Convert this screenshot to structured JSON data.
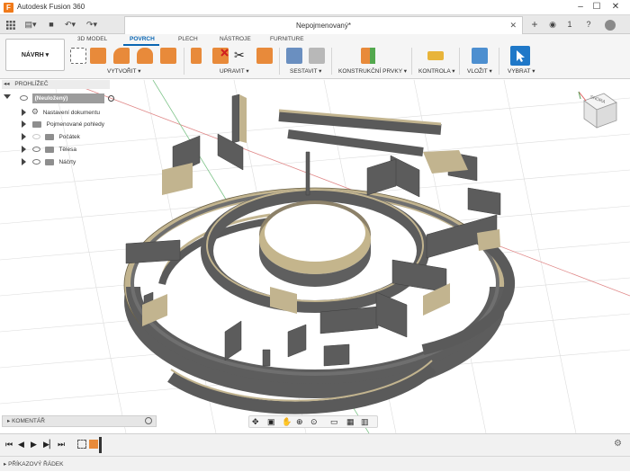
{
  "window": {
    "title": "Autodesk Fusion 360",
    "app_icon_letter": "F"
  },
  "document_tab": {
    "title": "Nepojmenovaný*"
  },
  "quick_access": {
    "data_panel_badge": "1"
  },
  "ribbon": {
    "workspace_label": "NÁVRH",
    "tabs": [
      "3D MODEL",
      "POVRCH",
      "PLECH",
      "NÁSTROJE",
      "FURNITURE"
    ],
    "active_tab": "POVRCH",
    "groups": [
      "VYTVOŘIT",
      "UPRAVIT",
      "SESTAVIT",
      "KONSTRUKČNÍ PRVKY",
      "KONTROLA",
      "VLOŽIT",
      "VYBRAT"
    ]
  },
  "browser": {
    "header": "PROHLÍŽEČ",
    "root_label": "(Neuložený)",
    "items": [
      "Nastavení dokumentu",
      "Pojmenované pohledy",
      "Počátek",
      "Tělesa",
      "Náčrty"
    ]
  },
  "viewcube": {
    "face_label": "SHORA"
  },
  "comments": {
    "label": "KOMENTÁŘ"
  },
  "command_line": {
    "label": "PŘÍKAZOVÝ ŘÁDEK"
  },
  "colors": {
    "accent": "#0a66b3",
    "wall_top": "#c2b48f",
    "wall_side": "#6e6e6e",
    "grid_red": "#e08888",
    "grid_green": "#7fc48a"
  }
}
